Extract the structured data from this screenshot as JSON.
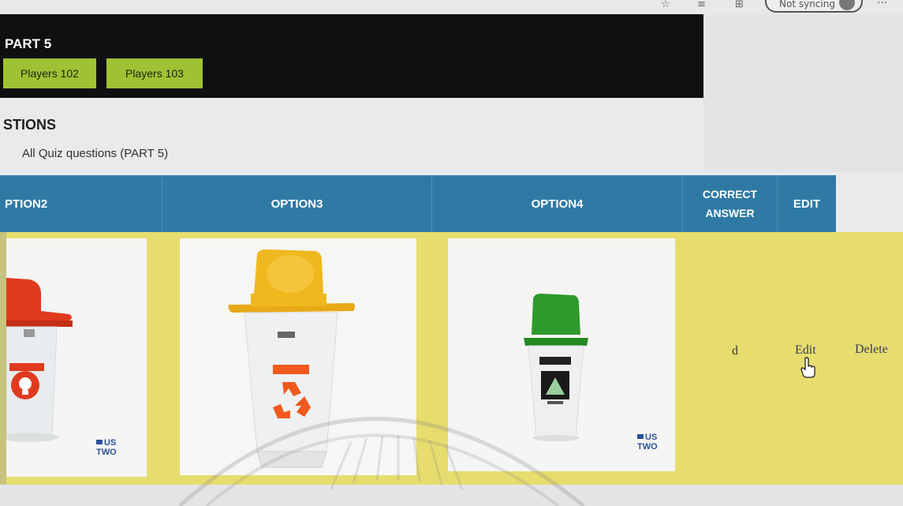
{
  "browser": {
    "sync_status": "Not syncing",
    "icons": [
      "favorites-icon",
      "reading-list-icon",
      "collections-icon",
      "profile-icon",
      "more-icon"
    ]
  },
  "header": {
    "part_title": "PART 5",
    "players": [
      {
        "label": "Players 102"
      },
      {
        "label": "Players 103"
      }
    ]
  },
  "section": {
    "title": "STIONS",
    "subtitle": "All Quiz questions (PART 5)"
  },
  "table": {
    "headers": {
      "option2": "PTION2",
      "option3": "OPTION3",
      "option4": "OPTION4",
      "correct_answer": "CORRECT\nANSWER",
      "edit": "EDIT"
    },
    "row": {
      "option2_image": "red-lid-hazard-bin",
      "option3_image": "yellow-lid-recycle-bin",
      "option4_image": "green-lid-bin",
      "correct_answer": "d",
      "edit_label": "Edit",
      "delete_label": "Delete"
    }
  },
  "logo_text": {
    "top": "US",
    "bottom": "TWO"
  },
  "colors": {
    "header_bg": "#0f1012",
    "player_button": "#9fc234",
    "table_header": "#2f7aa5",
    "row_bg": "#e6dd6e",
    "bin_red": "#e03a1e",
    "bin_yellow": "#efb81e",
    "bin_green": "#2f9a2c",
    "recycle_orange": "#f05a1e"
  }
}
